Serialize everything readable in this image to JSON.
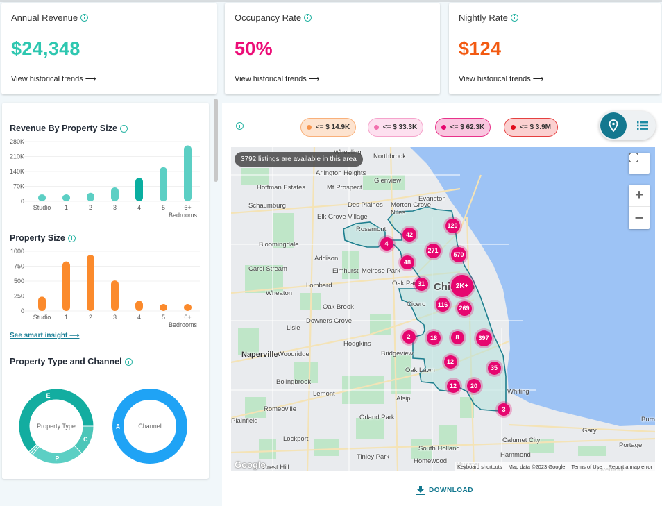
{
  "kpis": [
    {
      "label": "Annual Revenue",
      "value": "$24,348",
      "color": "#2ec7b0",
      "link": "View historical trends ⟶"
    },
    {
      "label": "Occupancy Rate",
      "value": "50%",
      "color": "#ec0d77",
      "link": "View historical trends ⟶"
    },
    {
      "label": "Nightly Rate",
      "value": "$124",
      "color": "#f25a12",
      "link": "View historical trends ⟶"
    }
  ],
  "left": {
    "revenue_title": "Revenue By Property Size",
    "size_title": "Property Size",
    "smart_insight": "See smart insight ⟶",
    "type_title": "Property Type and Channel",
    "donut_type_center": "Property Type",
    "donut_channel_center": "Channel"
  },
  "chart_data": [
    {
      "type": "bar",
      "title": "Revenue By Property Size",
      "categories": [
        "Studio",
        "1",
        "2",
        "3",
        "4",
        "5",
        "6+"
      ],
      "xlabel": "Bedrooms",
      "values": [
        30000,
        32000,
        40000,
        65000,
        110000,
        160000,
        262000
      ],
      "highlight_index": 4,
      "yticks": [
        "0",
        "70K",
        "140K",
        "210K",
        "280K"
      ],
      "ylim": [
        0,
        280000
      ],
      "color": "#5ccfc4",
      "highlight_color": "#0aaea0"
    },
    {
      "type": "bar",
      "title": "Property Size",
      "categories": [
        "Studio",
        "1",
        "2",
        "3",
        "4",
        "5",
        "6+"
      ],
      "xlabel": "Bedrooms",
      "values": [
        240,
        830,
        940,
        510,
        170,
        50,
        30
      ],
      "yticks": [
        "0",
        "250",
        "500",
        "750",
        "1000"
      ],
      "ylim": [
        0,
        1000
      ],
      "color": "#fb8a2c"
    },
    {
      "type": "pie",
      "title": "Property Type",
      "slices": [
        {
          "label": "E",
          "value": 62,
          "color": "#13ada0"
        },
        {
          "label": "",
          "value": 1,
          "color": "#5ccfc4"
        },
        {
          "label": "",
          "value": 1,
          "color": "#5ccfc4"
        },
        {
          "label": "P",
          "value": 23,
          "color": "#5ccfc4"
        },
        {
          "label": "C",
          "value": 13,
          "color": "#4cc6b9"
        }
      ]
    },
    {
      "type": "pie",
      "title": "Channel",
      "slices": [
        {
          "label": "A",
          "value": 100,
          "color": "#1fa3f5"
        }
      ]
    }
  ],
  "map": {
    "legend": [
      {
        "label": "<= $ 14.9K",
        "bg": "#fde3cf",
        "border": "#f9b07a",
        "dot": "#f7934a"
      },
      {
        "label": "<= $ 33.3K",
        "bg": "#fde0ef",
        "border": "#f5a3cb",
        "dot": "#f26fae"
      },
      {
        "label": "<= $ 62.3K",
        "bg": "#f9c6df",
        "border": "#e8328a",
        "dot": "#e6066f"
      },
      {
        "label": "<= $ 3.9M",
        "bg": "#fbd0d0",
        "border": "#e54040",
        "dot": "#e00b1b"
      }
    ],
    "banner": "3792 listings are available in this area",
    "clusters": [
      "120",
      "42",
      "4",
      "271",
      "570",
      "48",
      "31",
      "2K+",
      "116",
      "269",
      "2",
      "18",
      "8",
      "397",
      "12",
      "35",
      "12",
      "20",
      "3"
    ],
    "places": [
      "Wheeling",
      "Northbrook",
      "Arlington Heights",
      "Glenview",
      "Hoffman Estates",
      "Mt Prospect",
      "Schaumburg",
      "Des Plaines",
      "Morton Grove",
      "Evanston",
      "Niles",
      "Elk Grove Village",
      "Rosemont",
      "Bloomingdale",
      "Addison",
      "Carol Stream",
      "Elmhurst",
      "Melrose Park",
      "Oak Park",
      "Chicago",
      "Lombard",
      "Wheaton",
      "Cicero",
      "Oak Brook",
      "Downers Grove",
      "Lisle",
      "Naperville",
      "Woodridge",
      "Hodgkins",
      "Bridgeview",
      "Oak Lawn",
      "Bolingbrook",
      "Lemont",
      "Alsip",
      "Whiting",
      "Romeoville",
      "Orland Park",
      "Plainfield",
      "Calumet City",
      "South Holland",
      "Gary",
      "Burns",
      "Lockport",
      "Hammond",
      "Portage",
      "Tinley Park",
      "Homewood",
      "Munster",
      "Crest Hill",
      "Liverpool"
    ],
    "attribution": [
      "Keyboard shortcuts",
      "Map data ©2023 Google",
      "Terms of Use",
      "Report a map error"
    ],
    "google": "Google"
  },
  "download": "DOWNLOAD"
}
